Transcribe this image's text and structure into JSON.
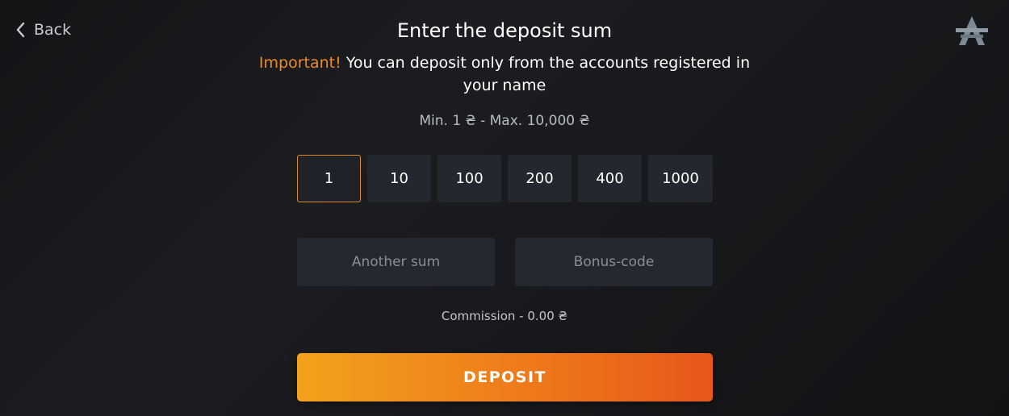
{
  "nav": {
    "back_label": "Back"
  },
  "header": {
    "title": "Enter the deposit sum",
    "notice_important": "Important!",
    "notice_text": " You can deposit only from the accounts registered in your name"
  },
  "limits": {
    "text": "Min. 1 ₴ - Max. 10,000 ₴"
  },
  "amounts": {
    "selected_index": 0,
    "options": [
      "1",
      "10",
      "100",
      "200",
      "400",
      "1000"
    ]
  },
  "inputs": {
    "another_sum_placeholder": "Another sum",
    "another_sum_value": "",
    "bonus_code_placeholder": "Bonus-code",
    "bonus_code_value": ""
  },
  "commission": {
    "text": "Commission - 0.00 ₴"
  },
  "actions": {
    "deposit_label": "DEPOSIT"
  },
  "colors": {
    "accent": "#f08a24",
    "button_start": "#f2a21c",
    "button_end": "#e8561a",
    "tile_bg": "#23272e",
    "selected_border": "#d98a2b"
  },
  "icons": {
    "back": "chevron-left-icon",
    "logo": "brand-logo-icon"
  }
}
